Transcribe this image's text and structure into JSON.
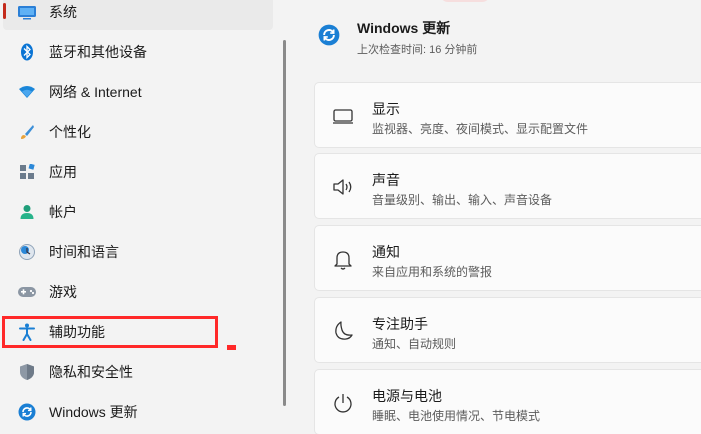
{
  "sidebar": {
    "items": [
      {
        "label": "系统",
        "icon": "system-icon"
      },
      {
        "label": "蓝牙和其他设备",
        "icon": "bluetooth-icon"
      },
      {
        "label": "网络 & Internet",
        "icon": "wifi-icon"
      },
      {
        "label": "个性化",
        "icon": "brush-icon"
      },
      {
        "label": "应用",
        "icon": "apps-icon"
      },
      {
        "label": "帐户",
        "icon": "account-icon"
      },
      {
        "label": "时间和语言",
        "icon": "time-language-icon"
      },
      {
        "label": "游戏",
        "icon": "gamepad-icon"
      },
      {
        "label": "辅助功能",
        "icon": "accessibility-icon"
      },
      {
        "label": "隐私和安全性",
        "icon": "shield-icon"
      },
      {
        "label": "Windows 更新",
        "icon": "windows-update-icon"
      }
    ],
    "selected_index": 0,
    "highlighted_index": 8
  },
  "update": {
    "title": "Windows 更新",
    "subtitle": "上次检查时间: 16 分钟前"
  },
  "cards": [
    {
      "title": "显示",
      "desc": "监视器、亮度、夜间模式、显示配置文件",
      "icon": "display-icon"
    },
    {
      "title": "声音",
      "desc": "音量级别、输出、输入、声音设备",
      "icon": "speaker-icon"
    },
    {
      "title": "通知",
      "desc": "来自应用和系统的警报",
      "icon": "bell-icon"
    },
    {
      "title": "专注助手",
      "desc": "通知、自动规则",
      "icon": "moon-icon"
    },
    {
      "title": "电源与电池",
      "desc": "睡眠、电池使用情况、节电模式",
      "icon": "power-icon"
    }
  ],
  "colors": {
    "accent": "#0067c0",
    "selection_bar": "#c42b1c",
    "highlight": "#ff2828"
  }
}
